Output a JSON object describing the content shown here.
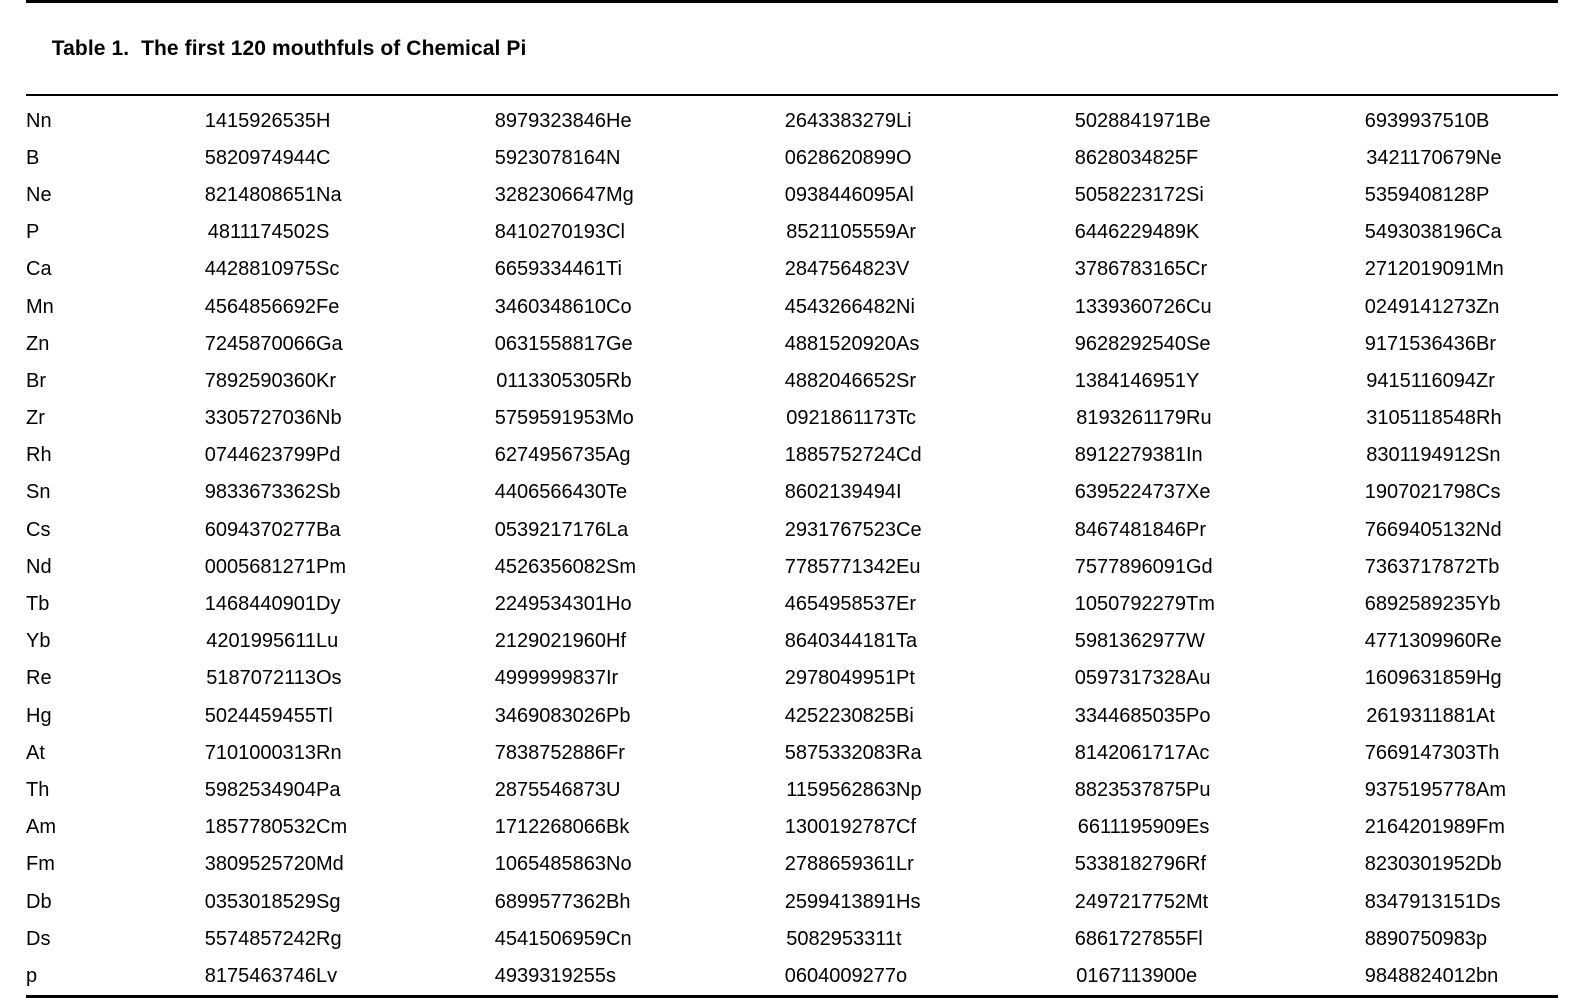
{
  "caption": {
    "label": "Table 1.",
    "text": "The first 120 mouthfuls of Chemical Pi",
    "full": "Table 1.  The first 120 mouthfuls of Chemical Pi"
  },
  "colors": {
    "text": "#000000",
    "background": "#ffffff",
    "rule": "#000000"
  },
  "table": {
    "row_count": 24,
    "pairs_per_row": 5,
    "trailing_symbol_column": true,
    "rows": [
      {
        "cells": [
          {
            "symbol": "Nn",
            "digits": "1415926535"
          },
          {
            "symbol": "H",
            "digits": "8979323846"
          },
          {
            "symbol": "He",
            "digits": "2643383279"
          },
          {
            "symbol": "Li",
            "digits": "5028841971"
          },
          {
            "symbol": "Be",
            "digits": "6939937510"
          }
        ],
        "trailing": "B"
      },
      {
        "cells": [
          {
            "symbol": "B",
            "digits": "5820974944"
          },
          {
            "symbol": "C",
            "digits": "5923078164"
          },
          {
            "symbol": "N",
            "digits": "0628620899"
          },
          {
            "symbol": "O",
            "digits": "8628034825"
          },
          {
            "symbol": "F",
            "digits": "3421170679"
          }
        ],
        "trailing": "Ne"
      },
      {
        "cells": [
          {
            "symbol": "Ne",
            "digits": "8214808651"
          },
          {
            "symbol": "Na",
            "digits": "3282306647"
          },
          {
            "symbol": "Mg",
            "digits": "0938446095"
          },
          {
            "symbol": "Al",
            "digits": "5058223172"
          },
          {
            "symbol": "Si",
            "digits": "5359408128"
          }
        ],
        "trailing": "P"
      },
      {
        "cells": [
          {
            "symbol": "P",
            "digits": "4811174502"
          },
          {
            "symbol": "S",
            "digits": "8410270193"
          },
          {
            "symbol": "Cl",
            "digits": "8521105559"
          },
          {
            "symbol": "Ar",
            "digits": "6446229489"
          },
          {
            "symbol": "K",
            "digits": "5493038196"
          }
        ],
        "trailing": "Ca"
      },
      {
        "cells": [
          {
            "symbol": "Ca",
            "digits": "4428810975"
          },
          {
            "symbol": "Sc",
            "digits": "6659334461"
          },
          {
            "symbol": "Ti",
            "digits": "2847564823"
          },
          {
            "symbol": "V",
            "digits": "3786783165"
          },
          {
            "symbol": "Cr",
            "digits": "2712019091"
          }
        ],
        "trailing": "Mn"
      },
      {
        "cells": [
          {
            "symbol": "Mn",
            "digits": "4564856692"
          },
          {
            "symbol": "Fe",
            "digits": "3460348610"
          },
          {
            "symbol": "Co",
            "digits": "4543266482"
          },
          {
            "symbol": "Ni",
            "digits": "1339360726"
          },
          {
            "symbol": "Cu",
            "digits": "0249141273"
          }
        ],
        "trailing": "Zn"
      },
      {
        "cells": [
          {
            "symbol": "Zn",
            "digits": "7245870066"
          },
          {
            "symbol": "Ga",
            "digits": "0631558817"
          },
          {
            "symbol": "Ge",
            "digits": "4881520920"
          },
          {
            "symbol": "As",
            "digits": "9628292540"
          },
          {
            "symbol": "Se",
            "digits": "9171536436"
          }
        ],
        "trailing": "Br"
      },
      {
        "cells": [
          {
            "symbol": "Br",
            "digits": "7892590360"
          },
          {
            "symbol": "Kr",
            "digits": "0113305305"
          },
          {
            "symbol": "Rb",
            "digits": "4882046652"
          },
          {
            "symbol": "Sr",
            "digits": "1384146951"
          },
          {
            "symbol": "Y",
            "digits": "9415116094"
          }
        ],
        "trailing": "Zr"
      },
      {
        "cells": [
          {
            "symbol": "Zr",
            "digits": "3305727036"
          },
          {
            "symbol": "Nb",
            "digits": "5759591953"
          },
          {
            "symbol": "Mo",
            "digits": "0921861173"
          },
          {
            "symbol": "Tc",
            "digits": "8193261179"
          },
          {
            "symbol": "Ru",
            "digits": "3105118548"
          }
        ],
        "trailing": "Rh"
      },
      {
        "cells": [
          {
            "symbol": "Rh",
            "digits": "0744623799"
          },
          {
            "symbol": "Pd",
            "digits": "6274956735"
          },
          {
            "symbol": "Ag",
            "digits": "1885752724"
          },
          {
            "symbol": "Cd",
            "digits": "8912279381"
          },
          {
            "symbol": "In",
            "digits": "8301194912"
          }
        ],
        "trailing": "Sn"
      },
      {
        "cells": [
          {
            "symbol": "Sn",
            "digits": "9833673362"
          },
          {
            "symbol": "Sb",
            "digits": "4406566430"
          },
          {
            "symbol": "Te",
            "digits": "8602139494"
          },
          {
            "symbol": "I",
            "digits": "6395224737"
          },
          {
            "symbol": "Xe",
            "digits": "1907021798"
          }
        ],
        "trailing": "Cs"
      },
      {
        "cells": [
          {
            "symbol": "Cs",
            "digits": "6094370277"
          },
          {
            "symbol": "Ba",
            "digits": "0539217176"
          },
          {
            "symbol": "La",
            "digits": "2931767523"
          },
          {
            "symbol": "Ce",
            "digits": "8467481846"
          },
          {
            "symbol": "Pr",
            "digits": "7669405132"
          }
        ],
        "trailing": "Nd"
      },
      {
        "cells": [
          {
            "symbol": "Nd",
            "digits": "0005681271"
          },
          {
            "symbol": "Pm",
            "digits": "4526356082"
          },
          {
            "symbol": "Sm",
            "digits": "7785771342"
          },
          {
            "symbol": "Eu",
            "digits": "7577896091"
          },
          {
            "symbol": "Gd",
            "digits": "7363717872"
          }
        ],
        "trailing": "Tb"
      },
      {
        "cells": [
          {
            "symbol": "Tb",
            "digits": "1468440901"
          },
          {
            "symbol": "Dy",
            "digits": "2249534301"
          },
          {
            "symbol": "Ho",
            "digits": "4654958537"
          },
          {
            "symbol": "Er",
            "digits": "1050792279"
          },
          {
            "symbol": "Tm",
            "digits": "6892589235"
          }
        ],
        "trailing": "Yb"
      },
      {
        "cells": [
          {
            "symbol": "Yb",
            "digits": "4201995611"
          },
          {
            "symbol": "Lu",
            "digits": "2129021960"
          },
          {
            "symbol": "Hf",
            "digits": "8640344181"
          },
          {
            "symbol": "Ta",
            "digits": "5981362977"
          },
          {
            "symbol": "W",
            "digits": "4771309960"
          }
        ],
        "trailing": "Re"
      },
      {
        "cells": [
          {
            "symbol": "Re",
            "digits": "5187072113"
          },
          {
            "symbol": "Os",
            "digits": "4999999837"
          },
          {
            "symbol": "Ir",
            "digits": "2978049951"
          },
          {
            "symbol": "Pt",
            "digits": "0597317328"
          },
          {
            "symbol": "Au",
            "digits": "1609631859"
          }
        ],
        "trailing": "Hg"
      },
      {
        "cells": [
          {
            "symbol": "Hg",
            "digits": "5024459455"
          },
          {
            "symbol": "Tl",
            "digits": "3469083026"
          },
          {
            "symbol": "Pb",
            "digits": "4252230825"
          },
          {
            "symbol": "Bi",
            "digits": "3344685035"
          },
          {
            "symbol": "Po",
            "digits": "2619311881"
          }
        ],
        "trailing": "At"
      },
      {
        "cells": [
          {
            "symbol": "At",
            "digits": "7101000313"
          },
          {
            "symbol": "Rn",
            "digits": "7838752886"
          },
          {
            "symbol": "Fr",
            "digits": "5875332083"
          },
          {
            "symbol": "Ra",
            "digits": "8142061717"
          },
          {
            "symbol": "Ac",
            "digits": "7669147303"
          }
        ],
        "trailing": "Th"
      },
      {
        "cells": [
          {
            "symbol": "Th",
            "digits": "5982534904"
          },
          {
            "symbol": "Pa",
            "digits": "2875546873"
          },
          {
            "symbol": "U",
            "digits": "1159562863"
          },
          {
            "symbol": "Np",
            "digits": "8823537875"
          },
          {
            "symbol": "Pu",
            "digits": "9375195778"
          }
        ],
        "trailing": "Am"
      },
      {
        "cells": [
          {
            "symbol": "Am",
            "digits": "1857780532"
          },
          {
            "symbol": "Cm",
            "digits": "1712268066"
          },
          {
            "symbol": "Bk",
            "digits": "1300192787"
          },
          {
            "symbol": "Cf",
            "digits": "6611195909"
          },
          {
            "symbol": "Es",
            "digits": "2164201989"
          }
        ],
        "trailing": "Fm"
      },
      {
        "cells": [
          {
            "symbol": "Fm",
            "digits": "3809525720"
          },
          {
            "symbol": "Md",
            "digits": "1065485863"
          },
          {
            "symbol": "No",
            "digits": "2788659361"
          },
          {
            "symbol": "Lr",
            "digits": "5338182796"
          },
          {
            "symbol": "Rf",
            "digits": "8230301952"
          }
        ],
        "trailing": "Db"
      },
      {
        "cells": [
          {
            "symbol": "Db",
            "digits": "0353018529"
          },
          {
            "symbol": "Sg",
            "digits": "6899577362"
          },
          {
            "symbol": "Bh",
            "digits": "2599413891"
          },
          {
            "symbol": "Hs",
            "digits": "2497217752"
          },
          {
            "symbol": "Mt",
            "digits": "8347913151"
          }
        ],
        "trailing": "Ds"
      },
      {
        "cells": [
          {
            "symbol": "Ds",
            "digits": "5574857242"
          },
          {
            "symbol": "Rg",
            "digits": "4541506959"
          },
          {
            "symbol": "Cn",
            "digits": "5082953311"
          },
          {
            "symbol": "t",
            "digits": "6861727855"
          },
          {
            "symbol": "Fl",
            "digits": "8890750983"
          }
        ],
        "trailing": "p"
      },
      {
        "cells": [
          {
            "symbol": "p",
            "digits": "8175463746"
          },
          {
            "symbol": "Lv",
            "digits": "4939319255"
          },
          {
            "symbol": "s",
            "digits": "0604009277"
          },
          {
            "symbol": "o",
            "digits": "0167113900"
          },
          {
            "symbol": "e",
            "digits": "9848824012"
          }
        ],
        "trailing": "bn"
      }
    ]
  }
}
